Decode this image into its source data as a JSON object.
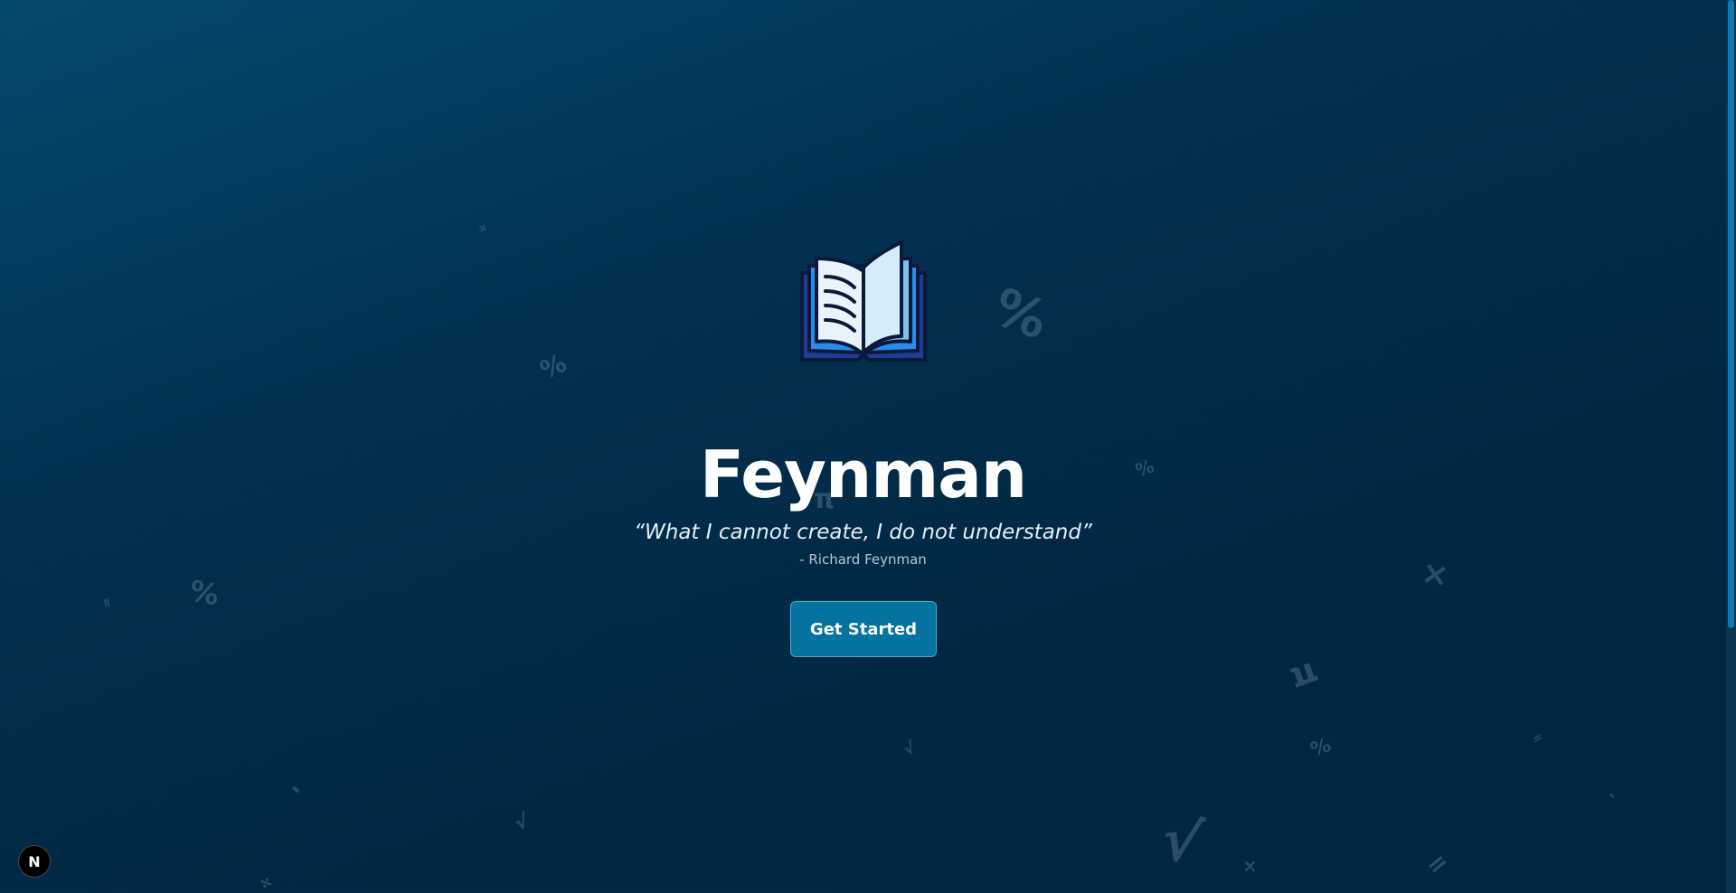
{
  "hero": {
    "logo_icon": "open-book-icon",
    "title": "Feynman",
    "quote": "“What I cannot create, I do not understand”",
    "author": "- Richard Feynman",
    "cta_label": "Get Started"
  },
  "background_symbols": [
    "%",
    "%",
    "%",
    "%",
    "%",
    "π",
    "π",
    "=",
    "=",
    "=",
    "√",
    "√",
    "√",
    "×",
    "×",
    "÷",
    "÷",
    "-",
    "-"
  ],
  "dev_badge": {
    "label": "N"
  },
  "colors": {
    "background_top": "#04496e",
    "background_bottom": "#01263f",
    "button": "#04739f",
    "button_border": "#4aa7cf",
    "scroll_thumb": "#0c7ab5",
    "text": "#ffffff"
  }
}
